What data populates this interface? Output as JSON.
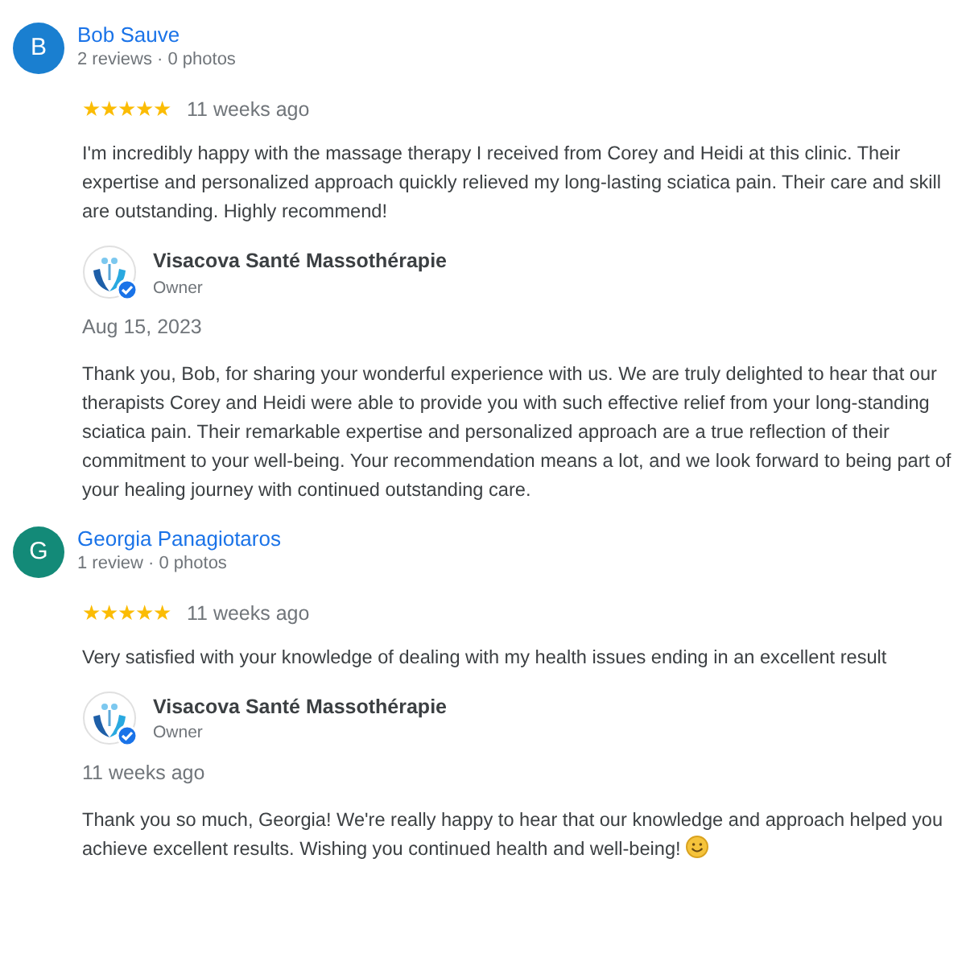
{
  "reviews": [
    {
      "initial": "B",
      "color": "#1a7fd0",
      "name": "Bob Sauve",
      "meta": "2 reviews · 0 photos",
      "stars": 5,
      "time": "11 weeks ago",
      "text": "I'm incredibly happy with the massage therapy I received from Corey and Heidi at this clinic. Their expertise and personalized approach quickly relieved my long-lasting sciatica pain. Their care and skill are outstanding. Highly recommend!",
      "response": {
        "name": "Visacova Santé Massothérapie",
        "role": "Owner",
        "date": "Aug 15, 2023",
        "text": "Thank you, Bob, for sharing your wonderful experience with us. We are truly delighted to hear that our therapists Corey and Heidi were able to provide you with such effective relief from your long-standing sciatica pain. Their remarkable expertise and personalized approach are a true reflection of their commitment to your well-being. Your recommendation means a lot, and we look forward to being part of your healing journey with continued outstanding care.",
        "emoji": false
      }
    },
    {
      "initial": "G",
      "color": "#138a78",
      "name": "Georgia Panagiotaros",
      "meta": "1 review · 0 photos",
      "stars": 5,
      "time": "11 weeks ago",
      "text": "Very satisfied with your knowledge of dealing with my health issues ending in an excellent result",
      "response": {
        "name": "Visacova Santé Massothérapie",
        "role": "Owner",
        "date": "11 weeks ago",
        "text": "Thank you so much, Georgia! We're really happy to hear that our knowledge and approach helped you achieve excellent results. Wishing you continued health and well-being!",
        "emoji": true
      }
    }
  ]
}
